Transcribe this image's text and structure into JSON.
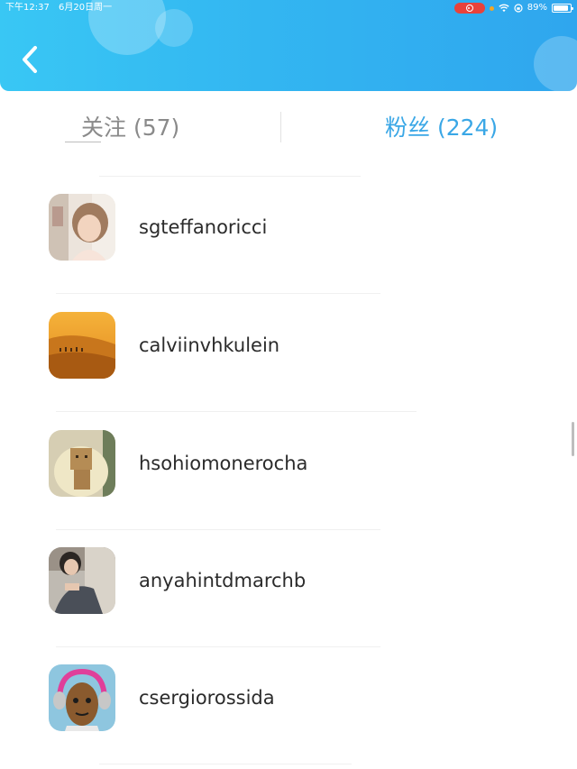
{
  "status_bar": {
    "time": "下午12:37",
    "date": "6月20日周一",
    "battery": "89%",
    "battery_level": 0.89
  },
  "header": {
    "back_icon": "chevron-left-icon"
  },
  "tabs": [
    {
      "label": "关注 (57)",
      "active": false
    },
    {
      "label": "粉丝 (224)",
      "active": true
    }
  ],
  "colors": {
    "header_start": "#39c7f4",
    "header_end": "#2fa6ee",
    "active_tab": "#3aa7e6",
    "inactive_tab": "#8a8a8a"
  },
  "followers": [
    {
      "username": "sgteffanoricci",
      "avatar": "avatar-girl-photo"
    },
    {
      "username": "calviinvhkulein",
      "avatar": "avatar-desert-camels"
    },
    {
      "username": "hsohiomonerocha",
      "avatar": "avatar-cardboard-robot"
    },
    {
      "username": "anyahintdmarchb",
      "avatar": "avatar-woman-photo"
    },
    {
      "username": "csergiorossida",
      "avatar": "avatar-cartoon-headphones"
    }
  ]
}
